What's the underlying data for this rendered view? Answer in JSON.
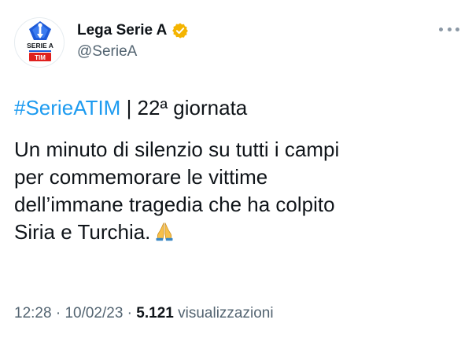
{
  "author": {
    "display_name": "Lega Serie A",
    "handle": "@SerieA",
    "verified": true,
    "verified_color": "#F4B400"
  },
  "avatar": {
    "logo_text_top": "SERIE A",
    "logo_text_bottom": "TIM",
    "accent_blue": "#1E5BD8",
    "accent_red": "#E0201E"
  },
  "tweet": {
    "hashtag": "#SerieATIM",
    "headline_rest": " | 22ª giornata",
    "body_lines": [
      "Un minuto di silenzio su tutti i campi",
      "per commemorare le vittime",
      "dell’immane tragedia che ha colpito",
      "Siria e Turchia."
    ],
    "emoji": "folded-hands-emoji"
  },
  "meta": {
    "time": "12:28",
    "sep1": " · ",
    "date": "10/02/23",
    "sep2": " · ",
    "views_count": "5.121",
    "views_label": " visualizzazioni"
  },
  "colors": {
    "link": "#1d9bf0",
    "secondary_text": "#536471",
    "primary_text": "#0f1419"
  }
}
